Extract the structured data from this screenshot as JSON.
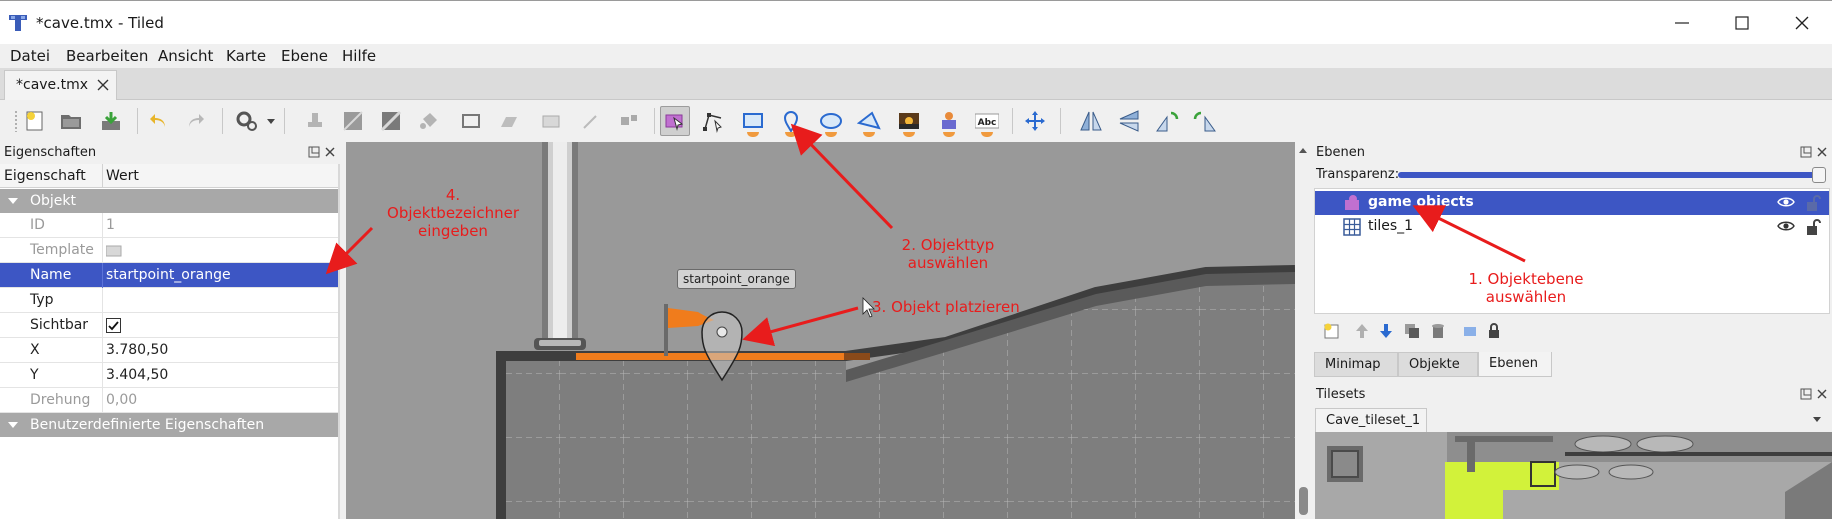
{
  "window": {
    "title": "*cave.tmx - Tiled"
  },
  "menu": [
    "Datei",
    "Bearbeiten",
    "Ansicht",
    "Karte",
    "Ebene",
    "Hilfe"
  ],
  "doc_tab": {
    "label": "*cave.tmx"
  },
  "properties": {
    "title": "Eigenschaften",
    "col_property": "Eigenschaft",
    "col_value": "Wert",
    "group_object": "Objekt",
    "rows": [
      {
        "key": "ID",
        "value": "1"
      },
      {
        "key": "Template",
        "value": ""
      },
      {
        "key": "Name",
        "value": "startpoint_orange"
      },
      {
        "key": "Typ",
        "value": ""
      },
      {
        "key": "Sichtbar",
        "value": ""
      },
      {
        "key": "X",
        "value": "3.780,50"
      },
      {
        "key": "Y",
        "value": "3.404,50"
      },
      {
        "key": "Drehung",
        "value": "0,00"
      }
    ],
    "group_custom": "Benutzerdefinierte Eigenschaften"
  },
  "canvas": {
    "object_label": "startpoint_orange"
  },
  "layers": {
    "title": "Ebenen",
    "opacity_label": "Transparenz:",
    "items": [
      {
        "name": "game objects"
      },
      {
        "name": "tiles_1"
      }
    ],
    "tabs": [
      "Minimap",
      "Objekte",
      "Ebenen"
    ]
  },
  "tilesets": {
    "title": "Tilesets",
    "tab": "Cave_tileset_1"
  },
  "annotations": {
    "step1": "1. Objektebene\nauswählen",
    "step2": "2. Objekttyp\nauswählen",
    "step3": "3. Objekt platzieren",
    "step4": "4.\nObjektbezeichner\neingeben"
  },
  "colors": {
    "selection": "#3d56c4",
    "annotation": "#e81c1c",
    "marker_orange": "#f07c1c"
  },
  "icons": [
    "tiled-logo-icon",
    "minimize-icon",
    "maximize-icon",
    "close-icon",
    "eye-icon",
    "lock-icon"
  ]
}
